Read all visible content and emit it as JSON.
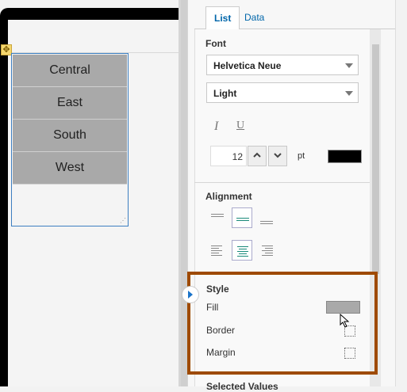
{
  "tabs": {
    "list": "List",
    "data": "Data"
  },
  "list_items": [
    "Central",
    "East",
    "South",
    "West"
  ],
  "font": {
    "section_title": "Font",
    "family": "Helvetica Neue",
    "weight": "Light",
    "size": "12",
    "unit": "pt",
    "color": "#000000"
  },
  "alignment": {
    "section_title": "Alignment",
    "vertical_selected": "middle",
    "horizontal_selected": "center"
  },
  "style": {
    "section_title": "Style",
    "fill_label": "Fill",
    "fill_color": "#a9a9a9",
    "border_label": "Border",
    "margin_label": "Margin"
  },
  "selected_values": {
    "section_title": "Selected Values"
  },
  "icons": {
    "italic": "I",
    "underline": "U",
    "move": "✥",
    "grip": "⋰"
  }
}
